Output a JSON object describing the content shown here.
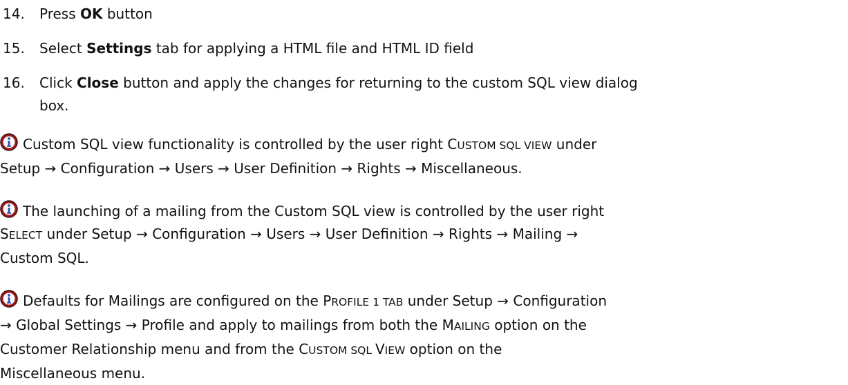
{
  "steps": [
    {
      "number": "14.",
      "pre": "Press ",
      "bold": "OK",
      "post": " button"
    },
    {
      "number": "15.",
      "pre": "Select ",
      "bold": "Settings",
      "post": " tab for applying a HTML file and HTML ID field"
    },
    {
      "number": "16.",
      "pre": "Click ",
      "bold": "Close",
      "post_line1": " button and apply the changes for returning to the custom SQL view dialog",
      "post_line2": "box."
    }
  ],
  "notes": [
    {
      "icon": "info-icon",
      "line1_pre": "Custom SQL view functionality is controlled by the user right ",
      "line1_sc_c": "C",
      "line1_sc_ustom": "USTOM",
      "line1_sc_sql": " SQL ",
      "line1_sc_view": "VIEW",
      "line1_post": " under",
      "line2": "Setup → Configuration → Users → User Definition → Rights → Miscellaneous."
    },
    {
      "icon": "info-icon",
      "line1": "The launching of a mailing from the Custom SQL view is controlled by the user right",
      "line2_sc_s": "S",
      "line2_sc_elect": "ELECT",
      "line2_post": " under Setup → Configuration → Users → User Definition → Rights → Mailing →",
      "line3": "Custom SQL."
    },
    {
      "icon": "info-icon",
      "line1_pre": "Defaults for Mailings are configured on the ",
      "line1_sc_p": "P",
      "line1_sc_rofile": "ROFILE",
      "line1_sc_1tab": " 1 TAB",
      "line1_post": " under Setup → Configuration",
      "line2_pre": "→ Global Settings → Profile and apply to mailings from both the ",
      "line2_sc_m": "M",
      "line2_sc_ailing": "AILING",
      "line2_post": " option on the",
      "line3_pre": "Customer Relationship menu and from the ",
      "line3_sc_c": "C",
      "line3_sc_ustom": "USTOM",
      "line3_sc_sql": " SQL ",
      "line3_sc_v": "V",
      "line3_sc_iew": "IEW",
      "line3_post": " option on the",
      "line4": "Miscellaneous menu."
    }
  ],
  "colors": {
    "icon_fill": "#a0191e",
    "icon_dark": "#3a1010",
    "icon_light": "#ffffff",
    "icon_dot": "#2b4fbf",
    "text": "#111111"
  }
}
